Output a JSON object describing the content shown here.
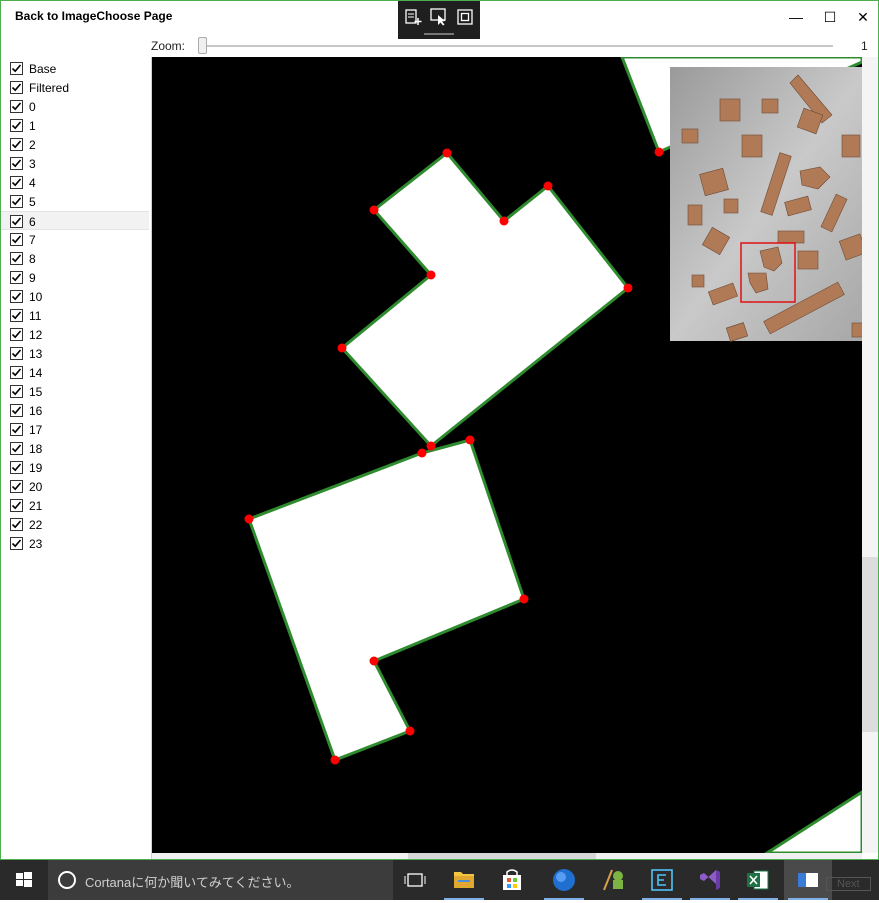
{
  "window": {
    "title": "Back to ImageChoose Page",
    "controls": {
      "minimize": "—",
      "maximize": "☐",
      "close": "✕"
    },
    "devtools": [
      "add-visual-icon",
      "select-element-icon",
      "layout-adorner-icon"
    ]
  },
  "zoom": {
    "label": "Zoom:",
    "value": "1",
    "level": 0
  },
  "layers": [
    {
      "label": "Base",
      "checked": true
    },
    {
      "label": "Filtered",
      "checked": true
    },
    {
      "label": "0",
      "checked": true
    },
    {
      "label": "1",
      "checked": true
    },
    {
      "label": "2",
      "checked": true
    },
    {
      "label": "3",
      "checked": true
    },
    {
      "label": "4",
      "checked": true
    },
    {
      "label": "5",
      "checked": true
    },
    {
      "label": "6",
      "checked": true,
      "selected": true
    },
    {
      "label": "7",
      "checked": true
    },
    {
      "label": "8",
      "checked": true
    },
    {
      "label": "9",
      "checked": true
    },
    {
      "label": "10",
      "checked": true
    },
    {
      "label": "11",
      "checked": true
    },
    {
      "label": "12",
      "checked": true
    },
    {
      "label": "13",
      "checked": true
    },
    {
      "label": "14",
      "checked": true
    },
    {
      "label": "15",
      "checked": true
    },
    {
      "label": "16",
      "checked": true
    },
    {
      "label": "17",
      "checked": true
    },
    {
      "label": "18",
      "checked": true
    },
    {
      "label": "19",
      "checked": true
    },
    {
      "label": "20",
      "checked": true
    },
    {
      "label": "21",
      "checked": true
    },
    {
      "label": "22",
      "checked": true
    },
    {
      "label": "23",
      "checked": true
    }
  ],
  "colors": {
    "outline": "#2e8b2e",
    "vertex": "#ff0000",
    "viewport_box": "#e01010",
    "shape_fill": "#ffffff",
    "background": "#000000"
  },
  "taskbar": {
    "search_placeholder": "Cortanaに何か聞いてみてください。",
    "icons": [
      "windows-start-icon",
      "task-view-icon",
      "file-explorer-icon",
      "store-icon",
      "browser-icon",
      "android-studio-icon",
      "editor-icon",
      "visual-studio-icon",
      "excel-icon",
      "app-window-icon"
    ],
    "hidden_label": "Next"
  }
}
